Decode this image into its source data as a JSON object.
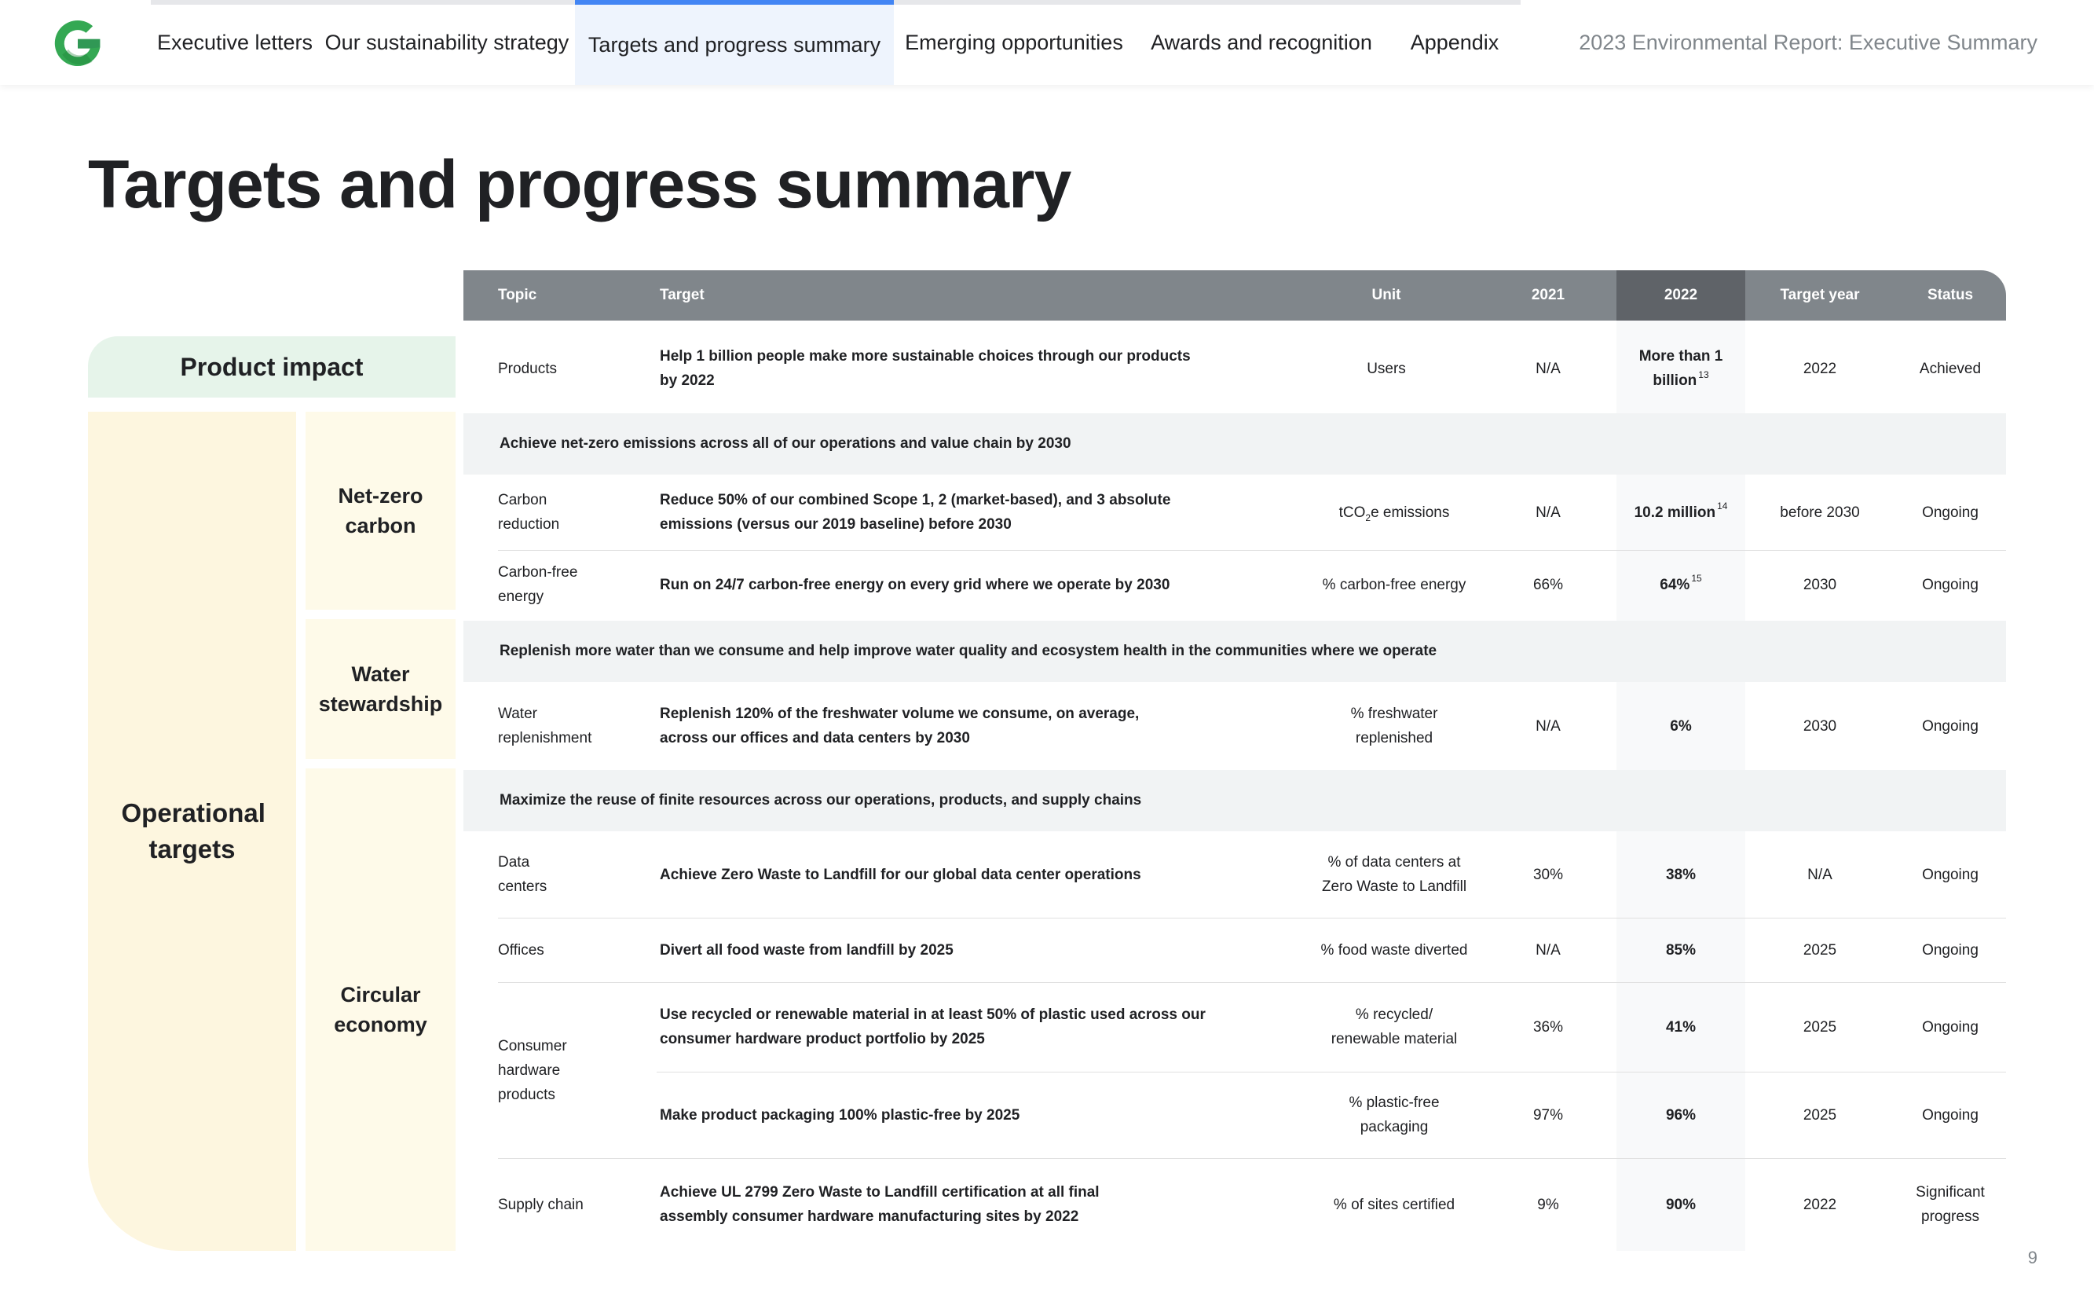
{
  "nav": {
    "tabs": [
      {
        "label": "Executive letters"
      },
      {
        "label": "Our sustainability strategy"
      },
      {
        "label": "Targets and progress summary"
      },
      {
        "label": "Emerging opportunities"
      },
      {
        "label": "Awards and recognition"
      },
      {
        "label": "Appendix"
      }
    ],
    "active_tab": "Targets and progress summary",
    "report_title": "2023 Environmental Report: Executive Summary",
    "logo_icon": "google-g-logo",
    "accent_color": "#4285f4"
  },
  "page": {
    "title": "Targets and progress summary",
    "page_number": "9"
  },
  "categories": {
    "product_impact": "Product impact",
    "operational_targets": "Operational targets",
    "net_zero_carbon": "Net-zero carbon",
    "water_stewardship": "Water stewardship",
    "circular_economy": "Circular economy"
  },
  "table": {
    "headers": {
      "topic": "Topic",
      "target": "Target",
      "unit": "Unit",
      "y2021": "2021",
      "y2022": "2022",
      "target_year": "Target year",
      "status": "Status"
    },
    "bands": {
      "net_zero": "Achieve net-zero emissions across all of our operations and value chain by 2030",
      "water": "Replenish more water than we consume and help improve water quality and ecosystem health in the communities where we operate",
      "circular": "Maximize the reuse of finite resources across our operations, products, and supply chains"
    },
    "rows": {
      "products": {
        "topic": "Products",
        "target": "Help 1 billion people make more sustainable choices through our products by 2022",
        "unit": "Users",
        "y2021": "N/A",
        "y2022": "More than 1 billion",
        "y2022_note": "13",
        "target_year": "2022",
        "status": "Achieved"
      },
      "carbon_reduction": {
        "topic": "Carbon reduction",
        "target": "Reduce 50% of our combined Scope 1, 2 (market-based), and 3 absolute emissions (versus our 2019 baseline) before 2030",
        "unit_pre": "tCO",
        "unit_sub": "2",
        "unit_post": "e emissions",
        "y2021": "N/A",
        "y2022": "10.2 million",
        "y2022_note": "14",
        "target_year": "before 2030",
        "status": "Ongoing"
      },
      "carbon_free_energy": {
        "topic": "Carbon-free energy",
        "target": "Run on 24/7 carbon-free energy on every grid where we operate by 2030",
        "unit": "% carbon-free energy",
        "y2021": "66%",
        "y2022": "64%",
        "y2022_note": "15",
        "target_year": "2030",
        "status": "Ongoing"
      },
      "water_replenishment": {
        "topic": "Water replenishment",
        "target": "Replenish 120% of the freshwater volume we consume, on average, across our offices and data centers by 2030",
        "unit": "% freshwater replenished",
        "y2021": "N/A",
        "y2022": "6%",
        "target_year": "2030",
        "status": "Ongoing"
      },
      "data_centers": {
        "topic": "Data centers",
        "target": "Achieve Zero Waste to Landfill for our global data center operations",
        "unit": "% of data centers at Zero Waste to Landfill",
        "y2021": "30%",
        "y2022": "38%",
        "target_year": "N/A",
        "status": "Ongoing"
      },
      "offices": {
        "topic": "Offices",
        "target": "Divert all food waste from landfill by 2025",
        "unit": "% food waste diverted",
        "y2021": "N/A",
        "y2022": "85%",
        "target_year": "2025",
        "status": "Ongoing"
      },
      "consumer_hardware": {
        "topic": "Consumer hardware products"
      },
      "recycled_material": {
        "target": "Use recycled or renewable material in at least 50% of plastic used across our consumer hardware product portfolio by 2025",
        "unit": "% recycled/ renewable material",
        "y2021": "36%",
        "y2022": "41%",
        "target_year": "2025",
        "status": "Ongoing"
      },
      "plastic_free": {
        "target": "Make product packaging 100% plastic-free by 2025",
        "unit": "% plastic-free packaging",
        "y2021": "97%",
        "y2022": "96%",
        "target_year": "2025",
        "status": "Ongoing"
      },
      "supply_chain": {
        "topic": "Supply chain",
        "target": "Achieve UL 2799 Zero Waste to Landfill certification at all final assembly consumer hardware manufacturing sites by 2022",
        "unit": "% of sites certified",
        "y2021": "9%",
        "y2022": "90%",
        "target_year": "2022",
        "status": "Significant progress"
      }
    }
  }
}
